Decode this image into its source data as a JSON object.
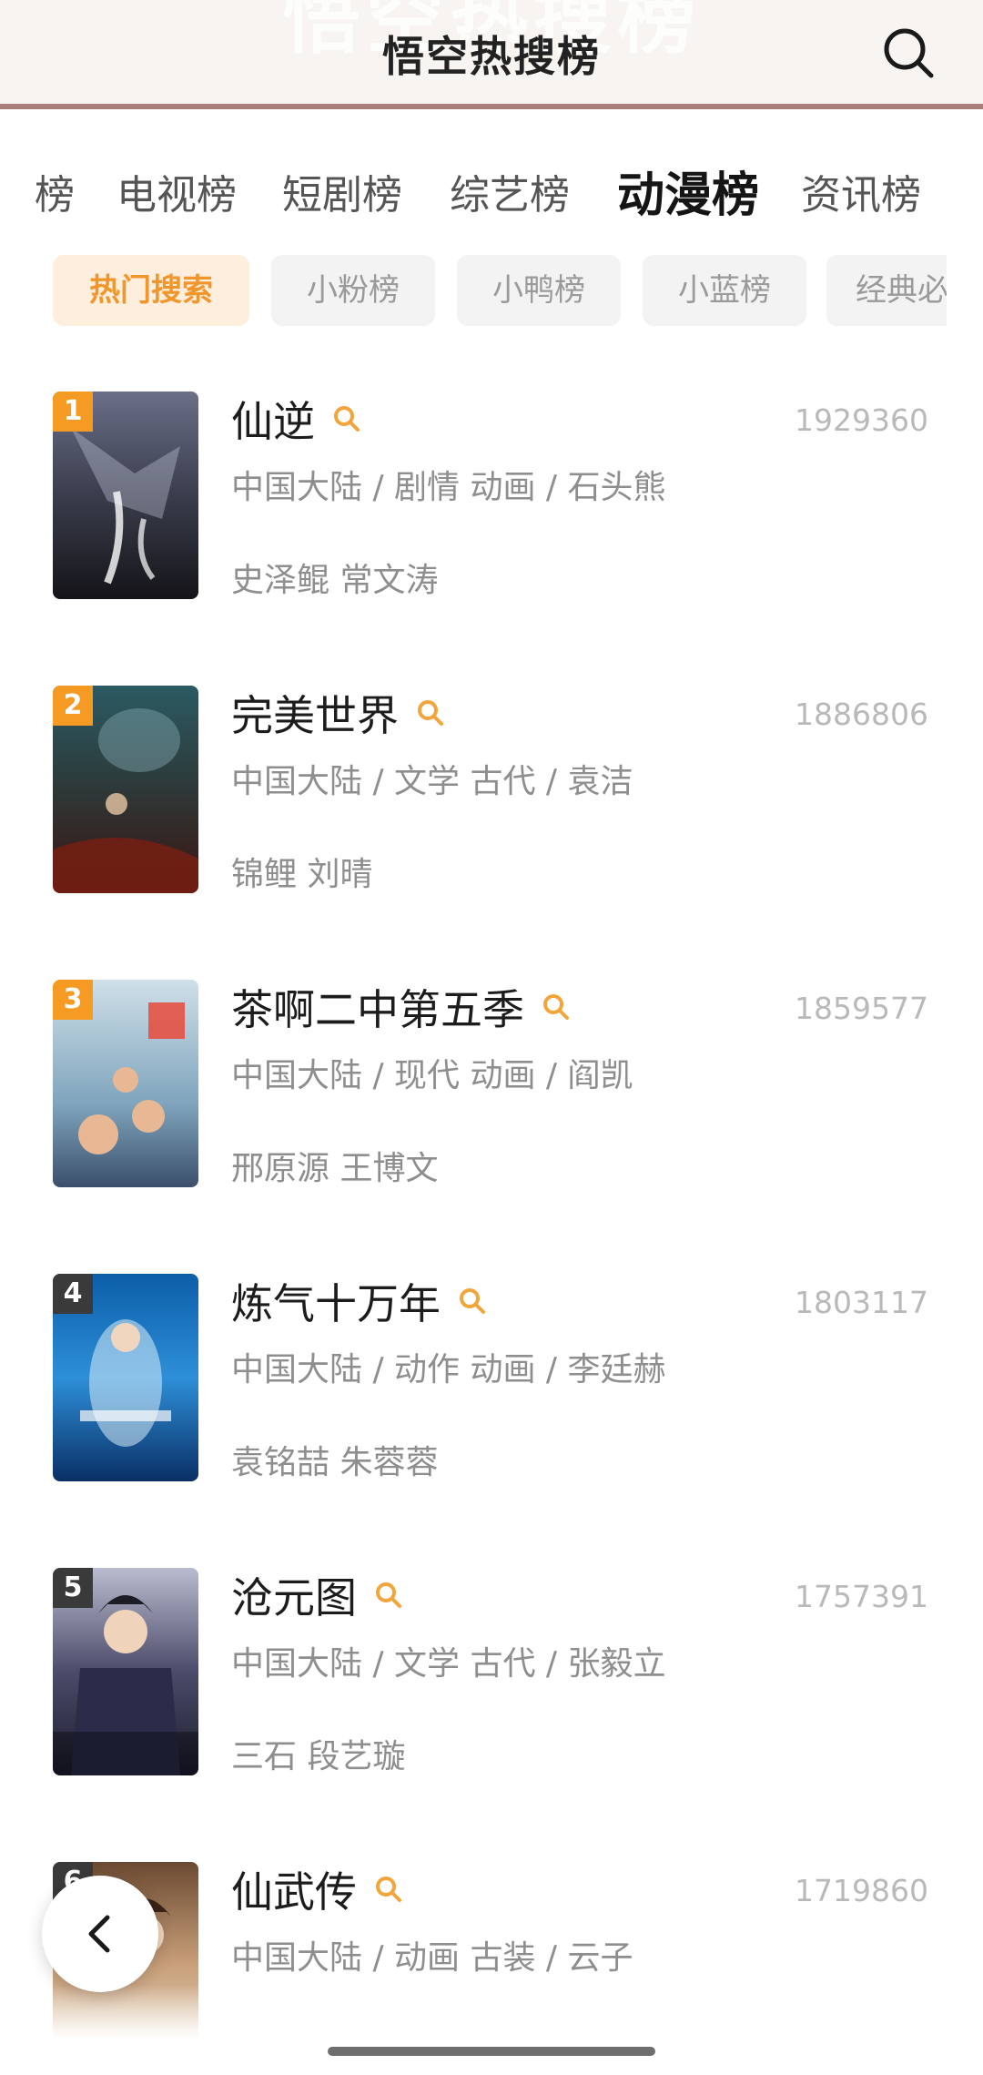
{
  "header": {
    "title": "悟空热搜榜",
    "ghost_text": "悟空热搜榜"
  },
  "tabs": [
    {
      "label": "榜"
    },
    {
      "label": "电视榜"
    },
    {
      "label": "短剧榜"
    },
    {
      "label": "综艺榜"
    },
    {
      "label": "动漫榜",
      "active": true
    },
    {
      "label": "资讯榜"
    }
  ],
  "chips": [
    {
      "label": "热门搜索",
      "active": true
    },
    {
      "label": "小粉榜"
    },
    {
      "label": "小鸭榜"
    },
    {
      "label": "小蓝榜"
    },
    {
      "label": "经典必"
    }
  ],
  "items": [
    {
      "rank": "1",
      "title": "仙逆",
      "count": "1929360",
      "meta": "中国大陆 / 剧情 动画 / 石头熊",
      "cast": "史泽鲲   常文涛",
      "rank_color": "#f59a23"
    },
    {
      "rank": "2",
      "title": "完美世界",
      "count": "1886806",
      "meta": "中国大陆 / 文学 古代 / 袁洁",
      "cast": "锦鲤   刘晴",
      "rank_color": "#f59a23"
    },
    {
      "rank": "3",
      "title": "茶啊二中第五季",
      "count": "1859577",
      "meta": "中国大陆 / 现代 动画 / 阎凯",
      "cast": "邢原源 王博文",
      "rank_color": "#f59a23"
    },
    {
      "rank": "4",
      "title": "炼气十万年",
      "count": "1803117",
      "meta": "中国大陆 / 动作 动画 / 李廷赫",
      "cast": "袁铭喆   朱蓉蓉",
      "rank_color": "#3a3a3a"
    },
    {
      "rank": "5",
      "title": "沧元图",
      "count": "1757391",
      "meta": "中国大陆 / 文学 古代 / 张毅立",
      "cast": "三石 段艺璇",
      "rank_color": "#3a3a3a"
    },
    {
      "rank": "6",
      "title": "仙武传",
      "count": "1719860",
      "meta": "中国大陆 / 动画 古装 / 云子",
      "cast": "",
      "rank_color": "#3a3a3a"
    }
  ],
  "colors": {
    "accent": "#f1962c",
    "header_line": "#a97f79"
  }
}
